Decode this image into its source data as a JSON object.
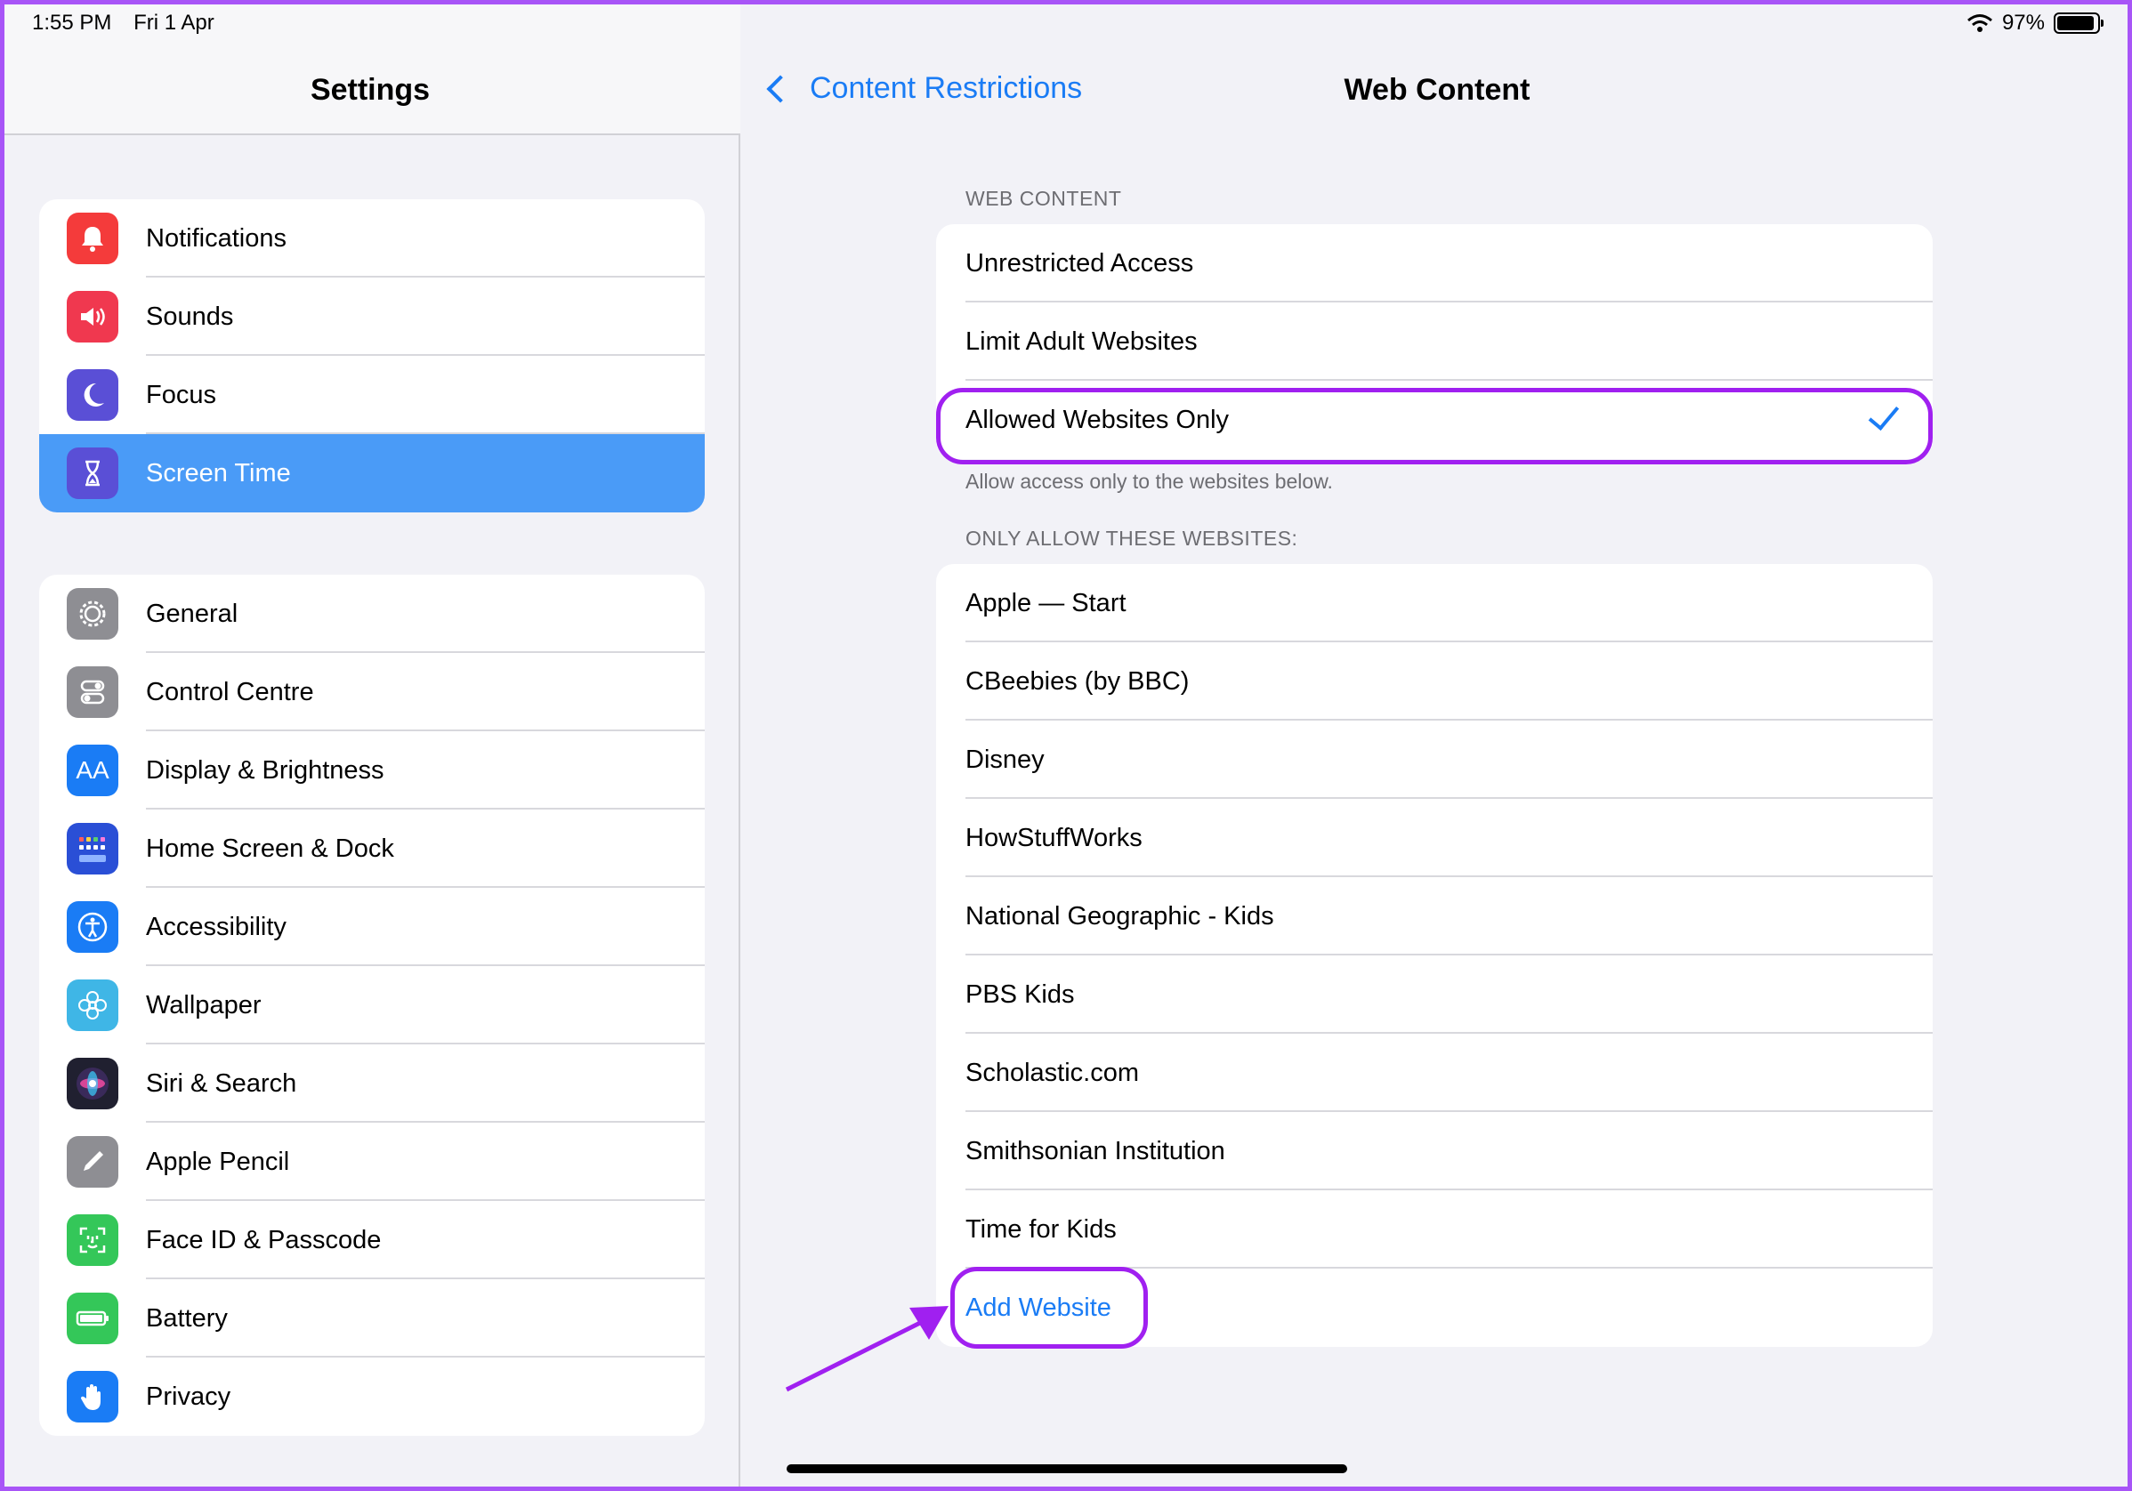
{
  "status": {
    "time": "1:55 PM",
    "date": "Fri 1 Apr",
    "battery": "97%"
  },
  "sidebar": {
    "title": "Settings",
    "group1": [
      {
        "label": "Notifications",
        "icon": "bell-icon",
        "color": "#f43b3b"
      },
      {
        "label": "Sounds",
        "icon": "speaker-icon",
        "color": "#f0384f"
      },
      {
        "label": "Focus",
        "icon": "moon-icon",
        "color": "#5a4fd6"
      },
      {
        "label": "Screen Time",
        "icon": "hourglass-icon",
        "color": "#5a4fd6",
        "selected": true
      }
    ],
    "group2": [
      {
        "label": "General",
        "icon": "gear-icon",
        "color": "#8e8e93"
      },
      {
        "label": "Control Centre",
        "icon": "toggles-icon",
        "color": "#8e8e93"
      },
      {
        "label": "Display & Brightness",
        "icon": "text-size-icon",
        "color": "#1a7cf5"
      },
      {
        "label": "Home Screen & Dock",
        "icon": "grid-icon",
        "color": "#2a4fd6"
      },
      {
        "label": "Accessibility",
        "icon": "accessibility-icon",
        "color": "#1a7cf5"
      },
      {
        "label": "Wallpaper",
        "icon": "flower-icon",
        "color": "#3fb6e6"
      },
      {
        "label": "Siri & Search",
        "icon": "siri-icon",
        "color": "#202030"
      },
      {
        "label": "Apple Pencil",
        "icon": "pencil-icon",
        "color": "#8e8e93"
      },
      {
        "label": "Face ID & Passcode",
        "icon": "face-id-icon",
        "color": "#34c759"
      },
      {
        "label": "Battery",
        "icon": "battery-icon",
        "color": "#34c759"
      },
      {
        "label": "Privacy",
        "icon": "hand-icon",
        "color": "#1a7cf5"
      }
    ]
  },
  "nav": {
    "back_label": "Content Restrictions",
    "title": "Web Content"
  },
  "web_content": {
    "header": "WEB CONTENT",
    "options": [
      "Unrestricted Access",
      "Limit Adult Websites",
      "Allowed Websites Only"
    ],
    "selected": "Allowed Websites Only",
    "footer": "Allow access only to the websites below."
  },
  "allowed": {
    "header": "ONLY ALLOW THESE WEBSITES:",
    "sites": [
      "Apple — Start",
      "CBeebies (by BBC)",
      "Disney",
      "HowStuffWorks",
      "National Geographic - Kids",
      "PBS Kids",
      "Scholastic.com",
      "Smithsonian Institution",
      "Time for Kids"
    ],
    "add_label": "Add Website"
  },
  "colors": {
    "accent": "#1a7cf5",
    "highlight": "#a020f0",
    "selected_row": "#4a9bf7"
  }
}
